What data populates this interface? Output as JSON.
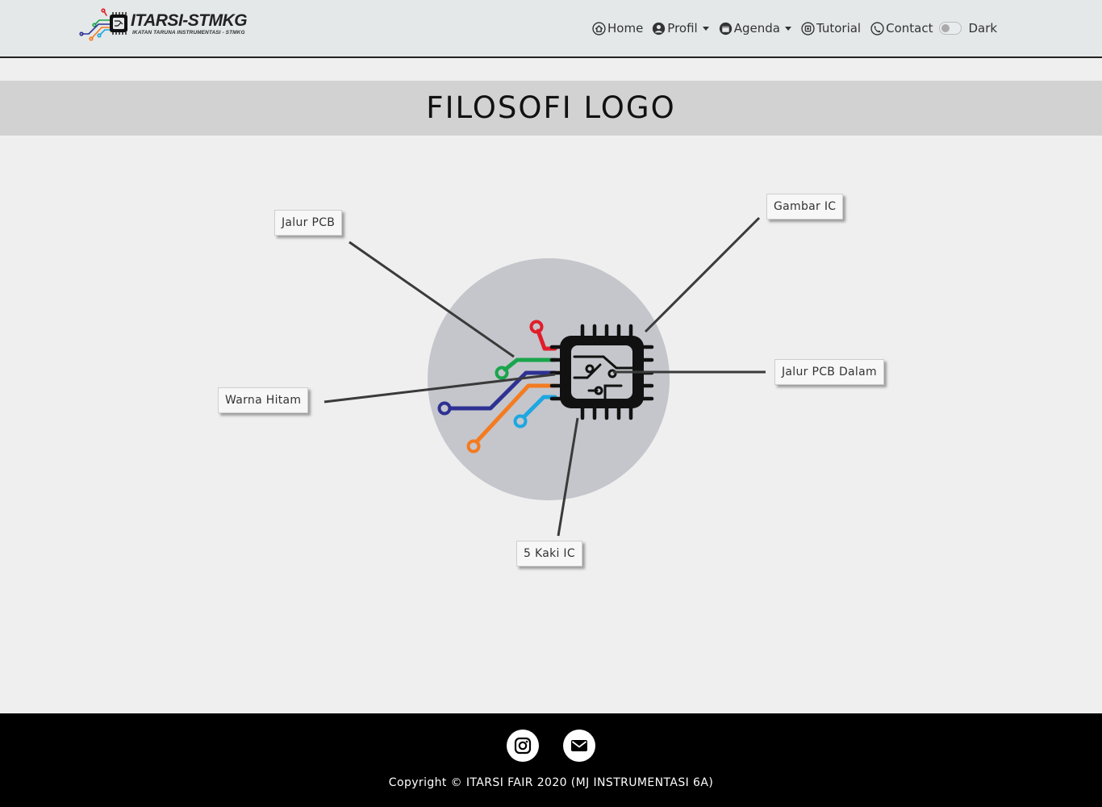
{
  "brand": {
    "title": "ITARSI-STMKG",
    "subtitle": "IKATAN TARUNA INSTRUMENTASI - STMKG"
  },
  "nav": {
    "home": "Home",
    "profil": "Profil",
    "agenda": "Agenda",
    "tutorial": "Tutorial",
    "contact": "Contact",
    "dark": "Dark"
  },
  "page": {
    "title": "FILOSOFI LOGO"
  },
  "labels": {
    "jalur_pcb": "Jalur PCB",
    "gambar_ic": "Gambar IC",
    "warna_hitam": "Warna Hitam",
    "jalur_pcb_dalam": "Jalur PCB Dalam",
    "kaki_ic": "5 Kaki IC"
  },
  "footer": {
    "copyright": "Copyright © ITARSI FAIR 2020 (MJ INSTRUMENTASI 6A)"
  },
  "colors": {
    "navbar_bg": "#e4e8e8",
    "title_band": "#d2d2d2",
    "circle": "#c4c6cc",
    "trace_red": "#e11d2a",
    "trace_green": "#1aa54b",
    "trace_navy": "#2e3192",
    "trace_orange": "#f47b20",
    "trace_cyan": "#1ea7e1",
    "chip": "#111111"
  },
  "icons": {
    "home": "home-icon",
    "profil": "user-circle-icon",
    "agenda": "calendar-icon",
    "tutorial": "chip-icon",
    "contact": "phone-icon",
    "instagram": "instagram-icon",
    "email": "envelope-icon"
  }
}
